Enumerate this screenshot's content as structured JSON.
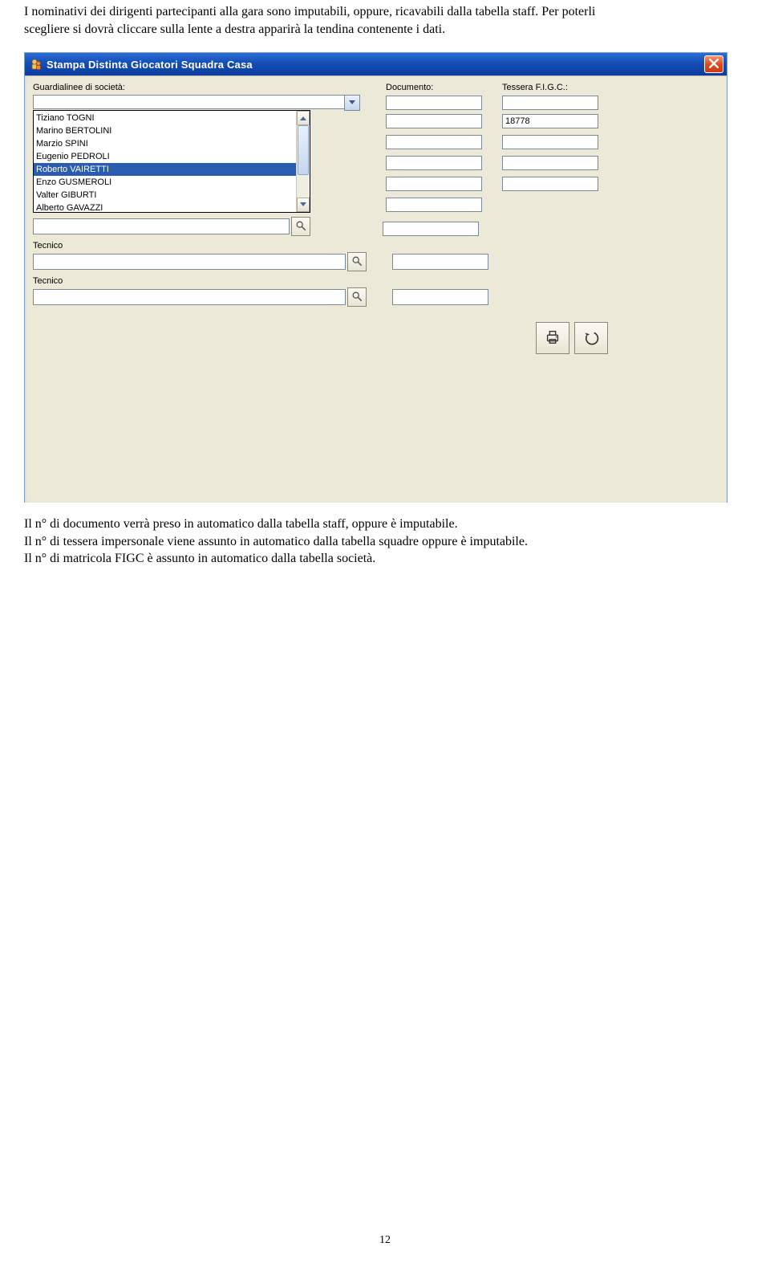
{
  "intro": {
    "line1": "I nominativi dei dirigenti partecipanti alla gara sono imputabili, oppure, ricavabili dalla tabella staff. Per poterli",
    "line2": "scegliere si dovrà cliccare sulla lente a destra apparirà la tendina contenente i dati."
  },
  "window": {
    "title": "Stampa Distinta Giocatori Squadra Casa",
    "labels": {
      "guardialinea": "Guardialinee di società:",
      "documento": "Documento:",
      "tessera": "Tessera F.I.G.C.:",
      "tecnico": "Tecnico"
    },
    "combo_value": "",
    "documento_value": "",
    "tessera_values": [
      "",
      "18778",
      "",
      "",
      ""
    ],
    "dropdown_items": [
      "Tiziano TOGNI",
      "Marino BERTOLINI",
      "Marzio SPINI",
      "Eugenio PEDROLI",
      "Roberto VAIRETTI",
      "Enzo GUSMEROLI",
      "Valter GIBURTI",
      "Alberto GAVAZZI"
    ],
    "dropdown_selected_index": 4
  },
  "body": {
    "p1": "Il n° di documento verrà preso in automatico dalla tabella staff, oppure è imputabile.",
    "p2": "Il n° di tessera impersonale viene assunto in automatico dalla tabella squadre oppure è imputabile.",
    "p3": "Il n° di matricola FIGC è assunto in automatico dalla tabella società."
  },
  "page_number": "12"
}
